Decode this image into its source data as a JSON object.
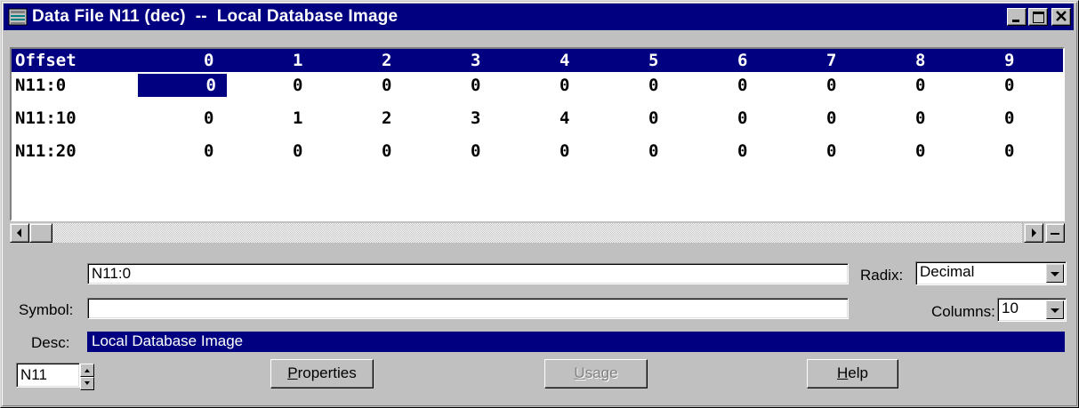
{
  "window": {
    "title": "Data File N11 (dec)  --  Local Database Image",
    "controls": [
      "minimize-icon",
      "maximize-icon",
      "close-icon"
    ]
  },
  "grid": {
    "header": [
      "Offset",
      "0",
      "1",
      "2",
      "3",
      "4",
      "5",
      "6",
      "7",
      "8",
      "9"
    ],
    "rows": [
      {
        "offset": "N11:0",
        "values": [
          "0",
          "0",
          "0",
          "0",
          "0",
          "0",
          "0",
          "0",
          "0",
          "0"
        ]
      },
      {
        "offset": "N11:10",
        "values": [
          "0",
          "1",
          "2",
          "3",
          "4",
          "0",
          "0",
          "0",
          "0",
          "0"
        ]
      },
      {
        "offset": "N11:20",
        "values": [
          "0",
          "0",
          "0",
          "0",
          "0",
          "0",
          "0",
          "0",
          "0",
          "0"
        ]
      }
    ],
    "selected_cell": "N11:0 / column 0"
  },
  "address": {
    "value": "N11:0"
  },
  "symbol": {
    "label": "Symbol:",
    "value": ""
  },
  "radix": {
    "label": "Radix:",
    "value": "Decimal"
  },
  "columns": {
    "label": "Columns:",
    "value": "10"
  },
  "desc": {
    "label": "Desc:",
    "value": "Local Database Image"
  },
  "file_selector": {
    "value": "N11"
  },
  "buttons": {
    "properties": {
      "pre": "",
      "accel": "P",
      "post": "roperties"
    },
    "usage": {
      "pre": "",
      "accel": "U",
      "post": "sage"
    },
    "help": {
      "pre": "",
      "accel": "H",
      "post": "elp"
    }
  },
  "colors": {
    "title_bar": "#000080",
    "window_bg": "#c0c0c0",
    "selection": "#000080"
  }
}
